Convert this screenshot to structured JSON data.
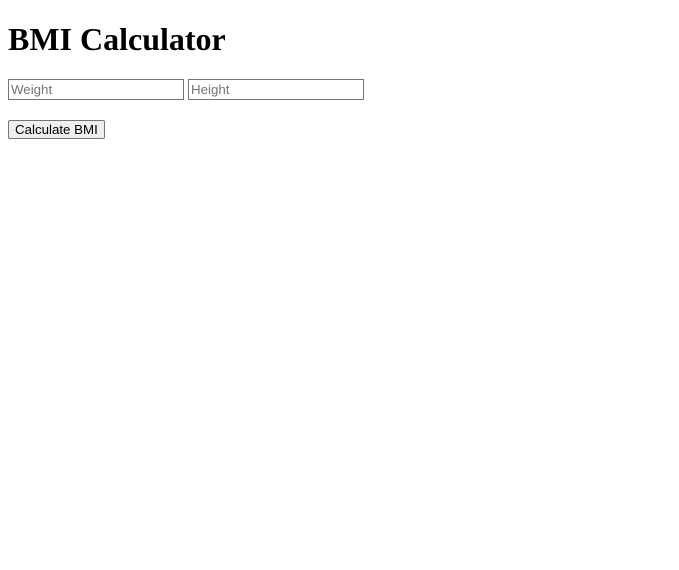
{
  "title": "BMI Calculator",
  "weight": {
    "placeholder": "Weight",
    "value": ""
  },
  "height": {
    "placeholder": "Height",
    "value": ""
  },
  "button_label": "Calculate BMI"
}
